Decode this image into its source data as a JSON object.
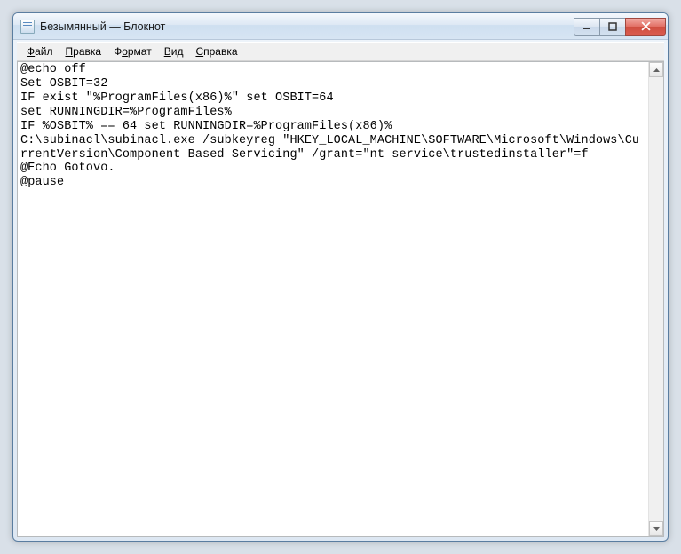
{
  "window": {
    "title": "Безымянный — Блокнот"
  },
  "menu": {
    "file": {
      "label": "Файл",
      "hotkey_index": 0
    },
    "edit": {
      "label": "Правка",
      "hotkey_index": 0
    },
    "format": {
      "label": "Формат",
      "hotkey_index": 1
    },
    "view": {
      "label": "Вид",
      "hotkey_index": 0
    },
    "help": {
      "label": "Справка",
      "hotkey_index": 0
    }
  },
  "editor": {
    "content": "@echo off\nSet OSBIT=32\nIF exist \"%ProgramFiles(x86)%\" set OSBIT=64\nset RUNNINGDIR=%ProgramFiles%\nIF %OSBIT% == 64 set RUNNINGDIR=%ProgramFiles(x86)%\nC:\\subinacl\\subinacl.exe /subkeyreg \"HKEY_LOCAL_MACHINE\\SOFTWARE\\Microsoft\\Windows\\CurrentVersion\\Component Based Servicing\" /grant=\"nt service\\trustedinstaller\"=f\n@Echo Gotovo.\n@pause"
  }
}
